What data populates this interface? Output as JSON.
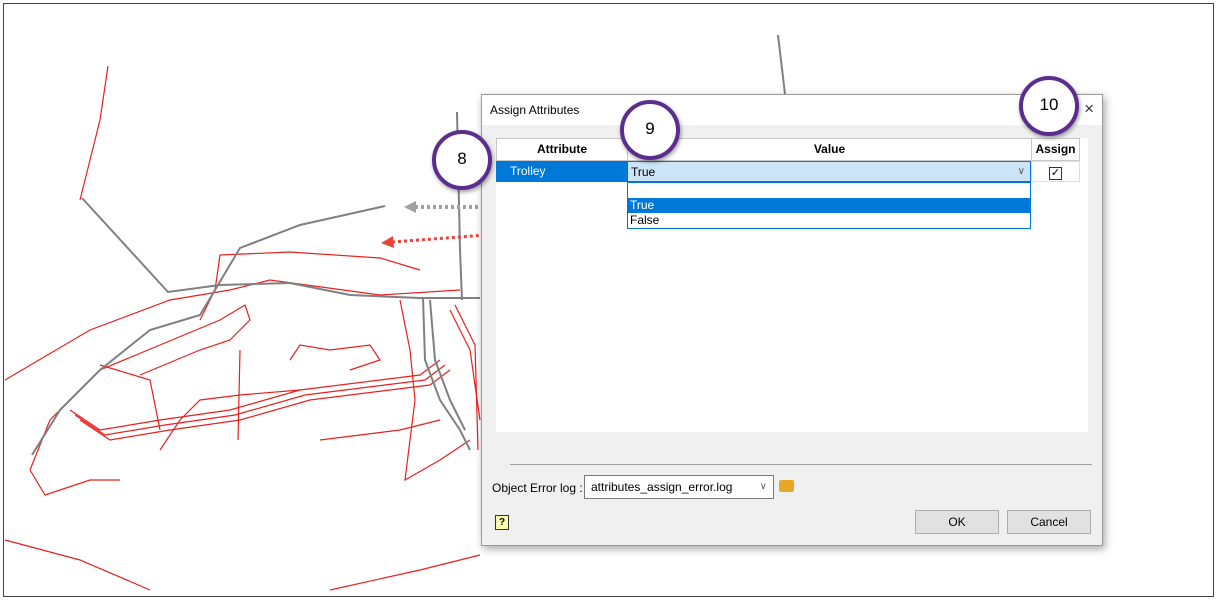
{
  "dialog": {
    "title": "Assign Attributes",
    "close_icon": "×"
  },
  "table": {
    "headers": [
      "Attribute",
      "Value",
      "Assign"
    ],
    "row": {
      "attribute": "Trolley",
      "value": "True",
      "assigned": true
    },
    "dropdown_options": [
      "",
      "True",
      "False"
    ],
    "selected_option": "True"
  },
  "error_log": {
    "label": "Object Error log :",
    "value": "attributes_assign_error.log"
  },
  "buttons": {
    "ok": "OK",
    "cancel": "Cancel",
    "help": "?"
  },
  "callouts": [
    "8",
    "9",
    "10"
  ],
  "colors": {
    "accent": "#0078d7",
    "callout": "#5b2d8e",
    "map_red": "#e8201f",
    "map_gray": "#808080"
  }
}
